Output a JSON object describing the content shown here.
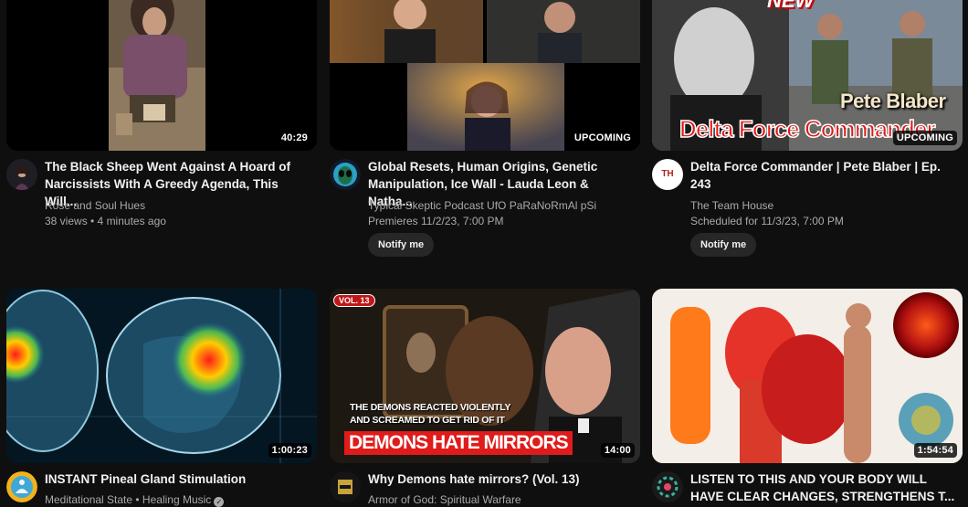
{
  "videos": [
    {
      "title": "The Black Sheep Went Against A Hoard of Narcissists With A Greedy Agenda, This Will...",
      "channel": "Rose and Soul Hues",
      "stats": "38 views • 4 minutes ago",
      "duration": "40:29"
    },
    {
      "title": "Global Resets, Human Origins, Genetic Manipulation, Ice Wall - Lauda Leon & Natha...",
      "channel": "Typical Skeptic Podcast UfO PaRaNoRmAl pSi",
      "stats": "Premieres 11/2/23, 7:00 PM",
      "duration": "UPCOMING",
      "notify_label": "Notify me"
    },
    {
      "title": "Delta Force Commander | Pete Blaber | Ep. 243",
      "channel": "The Team House",
      "stats": "Scheduled for 11/3/23, 7:00 PM",
      "duration": "UPCOMING",
      "notify_label": "Notify me",
      "thumb_text": {
        "badge": "NEW",
        "name": "Pete Blaber",
        "headline": "Delta Force Commander"
      },
      "avatar_text": "TH"
    },
    {
      "title": "INSTANT Pineal Gland Stimulation",
      "channel": "Meditational State • Healing Music",
      "duration": "1:00:23"
    },
    {
      "title": "Why Demons hate mirrors? (Vol. 13)",
      "channel": "Armor of God: Spiritual Warfare",
      "duration": "14:00",
      "thumb_text": {
        "vol": "VOL. 13",
        "line1": "THE DEMONS REACTED VIOLENTLY",
        "line2": "AND SCREAMED TO GET RID OF IT",
        "banner": "DEMONS HATE MIRRORS"
      }
    },
    {
      "title": "LISTEN TO THIS AND YOUR BODY WILL HAVE CLEAR CHANGES, STRENGTHENS T...",
      "duration": "1:54:54"
    }
  ],
  "colors": {
    "background": "#0f0f0f",
    "title_text": "#f1f1f1",
    "meta_text": "#aaaaaa",
    "button_bg": "#272727",
    "banner_red": "#e01b1b"
  },
  "icons": {
    "verified": "verified-check-icon"
  }
}
